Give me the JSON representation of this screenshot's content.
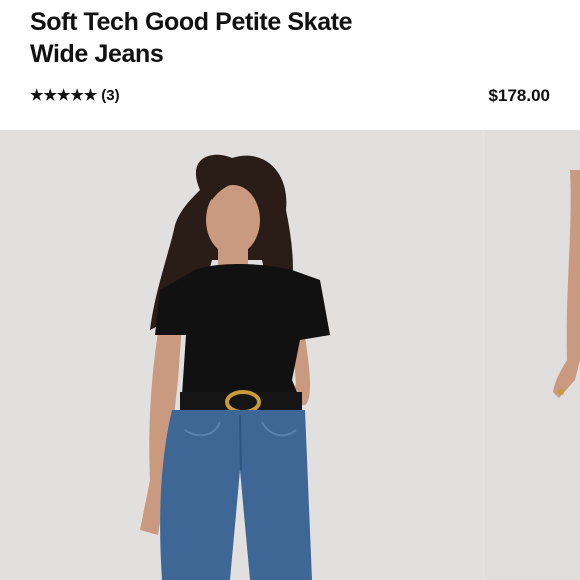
{
  "product": {
    "title_line1": "Soft Tech Good Petite Skate",
    "title_line2": "Wide Jeans",
    "stars": "★★★★★",
    "rating": 5,
    "review_count": "(3)",
    "price": "$178.00"
  },
  "gallery": {
    "main_image_icon": "product-photo-model",
    "next_image_icon": "product-photo-next",
    "colors": {
      "background": "#e6e3e2",
      "shirt": "#111111",
      "denim": "#3f6796",
      "hair": "#2a1c16",
      "skin": "#c99a7f",
      "buckle": "#c89a3a"
    }
  }
}
